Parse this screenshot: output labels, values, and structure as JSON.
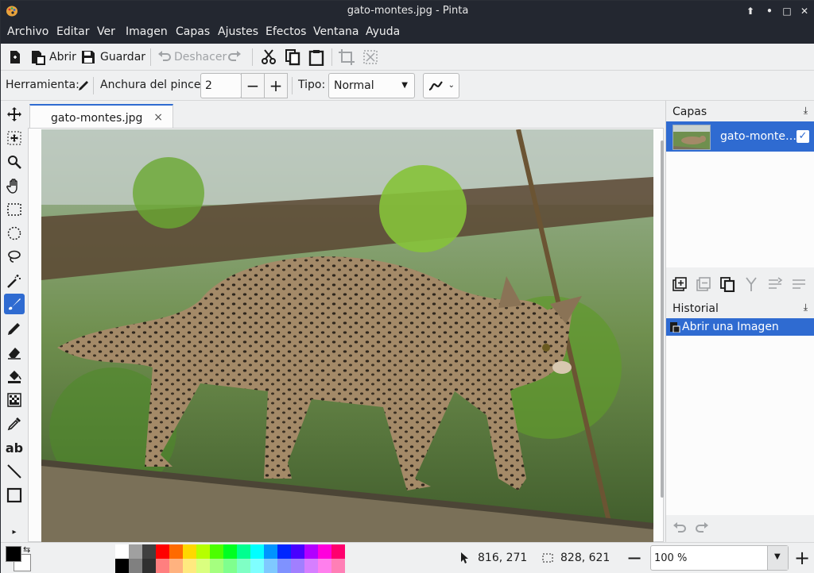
{
  "window": {
    "title": "gato-montes.jpg - Pinta"
  },
  "menu": [
    "Archivo",
    "Editar",
    "Ver",
    "Imagen",
    "Capas",
    "Ajustes",
    "Efectos",
    "Ventana",
    "Ayuda"
  ],
  "toolbar": {
    "open": "Abrir",
    "save": "Guardar",
    "undo": "Deshacer"
  },
  "options": {
    "tool_label": "Herramienta:",
    "brush_width_label": "Anchura del pincel:",
    "brush_width_value": "2",
    "type_label": "Tipo:",
    "type_value": "Normal"
  },
  "document": {
    "tab_name": "gato-montes.jpg",
    "close": "×"
  },
  "layers": {
    "header": "Capas",
    "items": [
      {
        "name": "gato-monte…",
        "visible": true
      }
    ]
  },
  "history": {
    "header": "Historial",
    "items": [
      {
        "name": "Abrir una Imagen"
      }
    ]
  },
  "status": {
    "cursor": "816, 271",
    "selection": "828, 621",
    "zoom": "100 %"
  },
  "palette_top": [
    "#ffffff",
    "#a0a0a0",
    "#404040",
    "#ff0000",
    "#ff6a00",
    "#ffd800",
    "#b6ff00",
    "#4cff00",
    "#00ff21",
    "#00ff90",
    "#00ffff",
    "#0094ff",
    "#0026ff",
    "#4800ff",
    "#b200ff",
    "#ff00dc",
    "#ff006e"
  ],
  "palette_bottom": [
    "#000000",
    "#808080",
    "#303030",
    "#ff7f7f",
    "#ffb27f",
    "#ffe97f",
    "#daff7f",
    "#a5ff7f",
    "#7fff8e",
    "#7fffc5",
    "#7fffff",
    "#7fc9ff",
    "#7f92ff",
    "#a17fff",
    "#d67fff",
    "#ff7fed",
    "#ff7fb6"
  ],
  "accent": "#2f6bd1"
}
